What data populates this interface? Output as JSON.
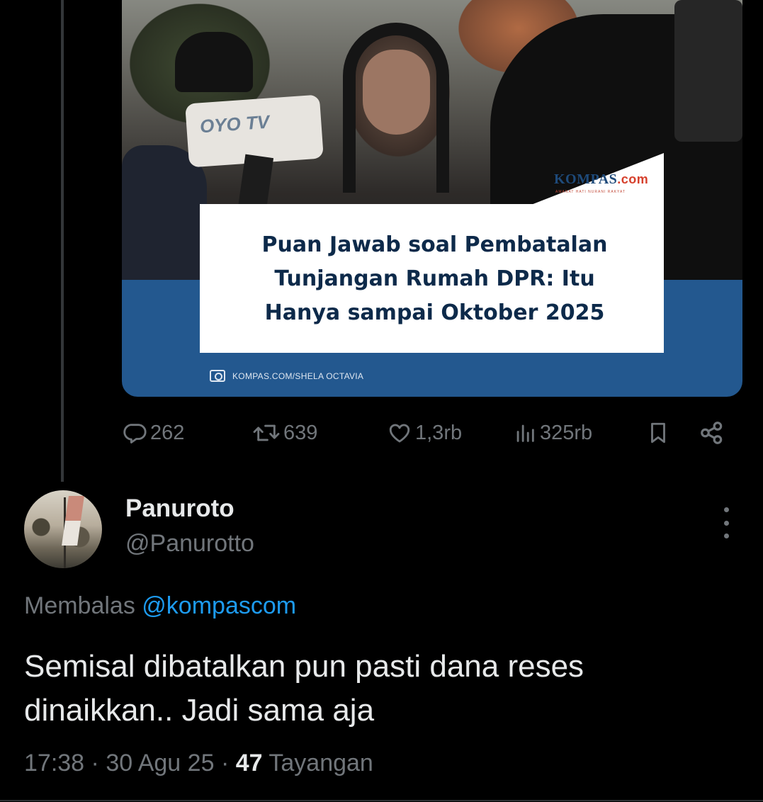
{
  "card": {
    "logo": "KOMPAS",
    "logo_suffix": ".com",
    "logo_tagline": "AMANAT HATI NURANI RAKYAT",
    "mic_label": "OYO TV",
    "headline_lines": [
      "Puan Jawab soal Pembatalan",
      "Tunjangan Rumah DPR: Itu",
      "Hanya sampai Oktober 2025"
    ],
    "photo_credit": "KOMPAS.COM/SHELA OCTAVIA"
  },
  "actions": {
    "replies": "262",
    "reposts": "639",
    "likes": "1,3rb",
    "views": "325rb"
  },
  "reply": {
    "name": "Panuroto",
    "handle": "@Panurotto",
    "replying_prefix": "Membalas",
    "replying_to": "@kompascom",
    "text_line1": "Semisal dibatalkan pun pasti dana reses",
    "text_line2": "dinaikkan.. Jadi sama aja",
    "time": "17:38",
    "date": "30 Agu 25",
    "views_count": "47",
    "views_label": "Tayangan"
  },
  "colors": {
    "background": "#000000",
    "text": "#e7e9ea",
    "muted": "#71767b",
    "link": "#1d9bf0",
    "card_blue": "#23588f"
  },
  "icons": [
    "reply-icon",
    "repost-icon",
    "like-icon",
    "views-icon",
    "bookmark-icon",
    "share-icon",
    "more-icon",
    "camera-icon"
  ]
}
